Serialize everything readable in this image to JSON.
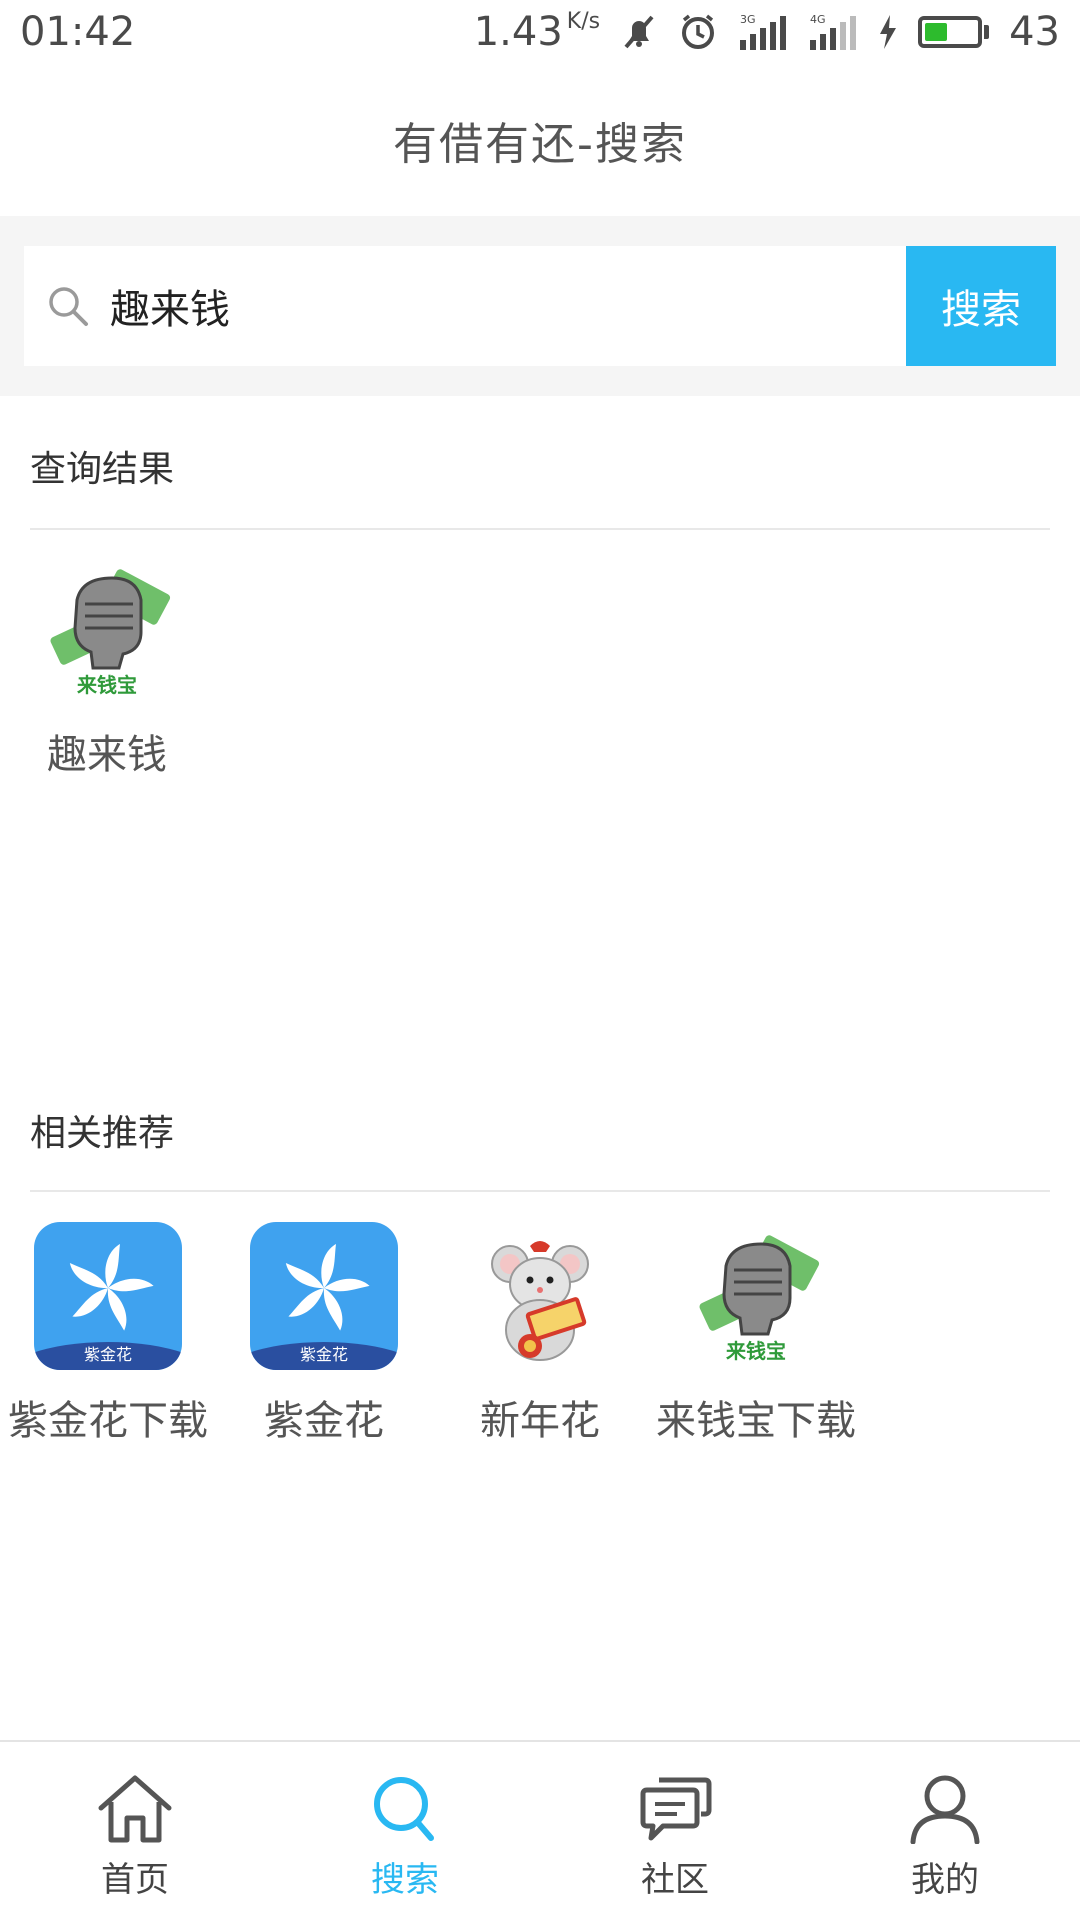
{
  "status_bar": {
    "time": "01:42",
    "speed": "1.43",
    "speed_unit": "K/s",
    "net1": "3G",
    "net2": "4G",
    "battery": "43",
    "battery_level": 0.43
  },
  "header": {
    "title": "有借有还-搜索"
  },
  "search": {
    "value": "趣来钱",
    "placeholder": "",
    "button_label": "搜索"
  },
  "results": {
    "title": "查询结果",
    "items": [
      {
        "name": "趣来钱",
        "icon": "fist-money-icon"
      }
    ]
  },
  "recommend": {
    "title": "相关推荐",
    "items": [
      {
        "name": "紫金花下载",
        "icon": "bauhinia-icon",
        "icon_text": "紫金花"
      },
      {
        "name": "紫金花",
        "icon": "bauhinia-icon",
        "icon_text": "紫金花"
      },
      {
        "name": "新年花",
        "icon": "new-year-mouse-icon"
      },
      {
        "name": "来钱宝下载",
        "icon": "fist-money-icon"
      }
    ]
  },
  "nav": {
    "items": [
      {
        "label": "首页",
        "icon": "home-icon"
      },
      {
        "label": "搜索",
        "icon": "search-icon",
        "active": true
      },
      {
        "label": "社区",
        "icon": "chat-icon"
      },
      {
        "label": "我的",
        "icon": "user-icon"
      }
    ]
  },
  "colors": {
    "accent": "#29b8f2",
    "battery": "#2dbb2d",
    "bauhinia_blue": "#3fa2ef"
  }
}
